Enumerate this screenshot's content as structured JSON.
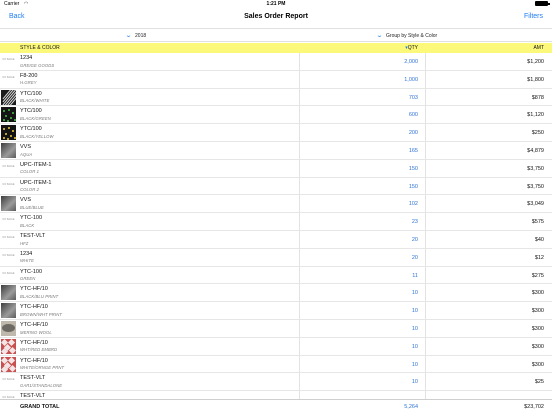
{
  "status_bar": {
    "carrier": "Carrier",
    "time": "1:21 PM"
  },
  "navbar": {
    "back_label": "Back",
    "title": "Sales Order Report",
    "filters_label": "Filters"
  },
  "selectors": {
    "year": "2018",
    "group": "Group by Style & Color"
  },
  "table": {
    "headers": {
      "style_color": "STYLE & COLOR",
      "qty": "QTY",
      "amt": "AMT"
    },
    "no_image_text": "NO IMAGE",
    "rows": [
      {
        "style": "1234",
        "color": "GREIGE GOODS",
        "qty": "2,000",
        "amt": "$1,200",
        "thumb": "none"
      },
      {
        "style": "F8-200",
        "color": "H.GREY",
        "qty": "1,000",
        "amt": "$1,800",
        "thumb": "none"
      },
      {
        "style": "YTC/100",
        "color": "BLACK/WHITE",
        "qty": "703",
        "amt": "$878",
        "thumb": "stripe"
      },
      {
        "style": "YTC/100",
        "color": "BLACK/GREEN",
        "qty": "600",
        "amt": "$1,120",
        "thumb": "dot-green"
      },
      {
        "style": "YTC/100",
        "color": "BLACK/YELLOW",
        "qty": "200",
        "amt": "$250",
        "thumb": "dot-yellow"
      },
      {
        "style": "VVS",
        "color": "AQUA",
        "qty": "165",
        "amt": "$4,879",
        "thumb": "soft"
      },
      {
        "style": "UPC-ITEM-1",
        "color": "COLOR 1",
        "qty": "150",
        "amt": "$3,750",
        "thumb": "none"
      },
      {
        "style": "UPC-ITEM-1",
        "color": "COLOR 2",
        "qty": "150",
        "amt": "$3,750",
        "thumb": "none"
      },
      {
        "style": "VVS",
        "color": "BLUE/BLUE",
        "qty": "102",
        "amt": "$3,049",
        "thumb": "soft"
      },
      {
        "style": "YTC-100",
        "color": "BLACK",
        "qty": "23",
        "amt": "$575",
        "thumb": "none"
      },
      {
        "style": "TEST-VLT",
        "color": "HFZ",
        "qty": "20",
        "amt": "$40",
        "thumb": "none"
      },
      {
        "style": "1234",
        "color": "WHITE",
        "qty": "20",
        "amt": "$12",
        "thumb": "none"
      },
      {
        "style": "YTC-100",
        "color": "GREEN",
        "qty": "11",
        "amt": "$275",
        "thumb": "none"
      },
      {
        "style": "YTC-HF/10",
        "color": "BLACK/BLU PRINT",
        "qty": "10",
        "amt": "$300",
        "thumb": "soft"
      },
      {
        "style": "YTC-HF/10",
        "color": "BROWN/WHT PRINT",
        "qty": "10",
        "amt": "$300",
        "thumb": "soft"
      },
      {
        "style": "YTC-HF/10",
        "color": "MERINO WOOL",
        "qty": "10",
        "amt": "$300",
        "thumb": "wool"
      },
      {
        "style": "YTC-HF/10",
        "color": "WHT/RED EMBRD",
        "qty": "10",
        "amt": "$300",
        "thumb": "pattern"
      },
      {
        "style": "YTC-HF/10",
        "color": "WHITE/ORNGE PRNT",
        "qty": "10",
        "amt": "$300",
        "thumb": "pattern"
      },
      {
        "style": "TEST-VLT",
        "color": "GAR1/STANDALONE",
        "qty": "10",
        "amt": "$25",
        "thumb": "none"
      },
      {
        "style": "TEST-VLT",
        "color": "",
        "qty": "",
        "amt": "",
        "thumb": "none"
      }
    ],
    "total": {
      "label": "GRAND TOTAL",
      "qty": "5,264",
      "amt": "$23,702"
    }
  },
  "colors": {
    "accent": "#1f7cf2",
    "header_bg": "#fbf87a",
    "qty_text": "#2f73d6"
  }
}
